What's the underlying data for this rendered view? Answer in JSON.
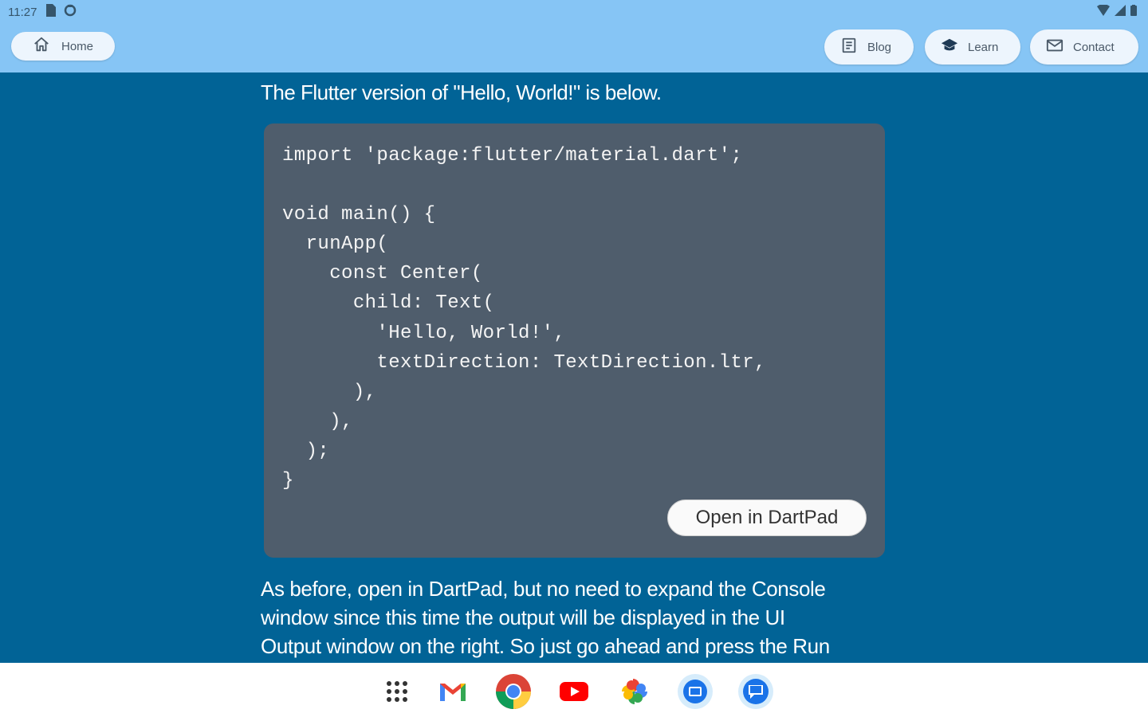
{
  "status_bar": {
    "time": "11:27",
    "icons": [
      "sd-card-icon",
      "sync-icon",
      "wifi-icon",
      "signal-icon",
      "battery-icon"
    ]
  },
  "app_bar": {
    "home_label": "Home",
    "blog_label": "Blog",
    "learn_label": "Learn",
    "contact_label": "Contact"
  },
  "main": {
    "intro": "The Flutter version of \"Hello, World!\" is below.",
    "code": "import 'package:flutter/material.dart';\n\nvoid main() {\n  runApp(\n    const Center(\n      child: Text(\n        'Hello, World!',\n        textDirection: TextDirection.ltr,\n      ),\n    ),\n  );\n}",
    "dartpad_button": "Open in DartPad",
    "body_lines": [
      "As before, open in DartPad, but no need to expand the Console",
      "window since this time the output will be displayed in the UI",
      "Output window on the right. So just go ahead and press the Run"
    ]
  },
  "taskbar": {
    "apps": [
      "app-launcher-icon",
      "gmail-icon",
      "chrome-icon",
      "youtube-icon",
      "photos-icon",
      "meet-icon",
      "messages-icon"
    ]
  },
  "colors": {
    "app_bar": "#86c5f5",
    "page_background": "#016396",
    "code_background": "#4f5d6c"
  }
}
